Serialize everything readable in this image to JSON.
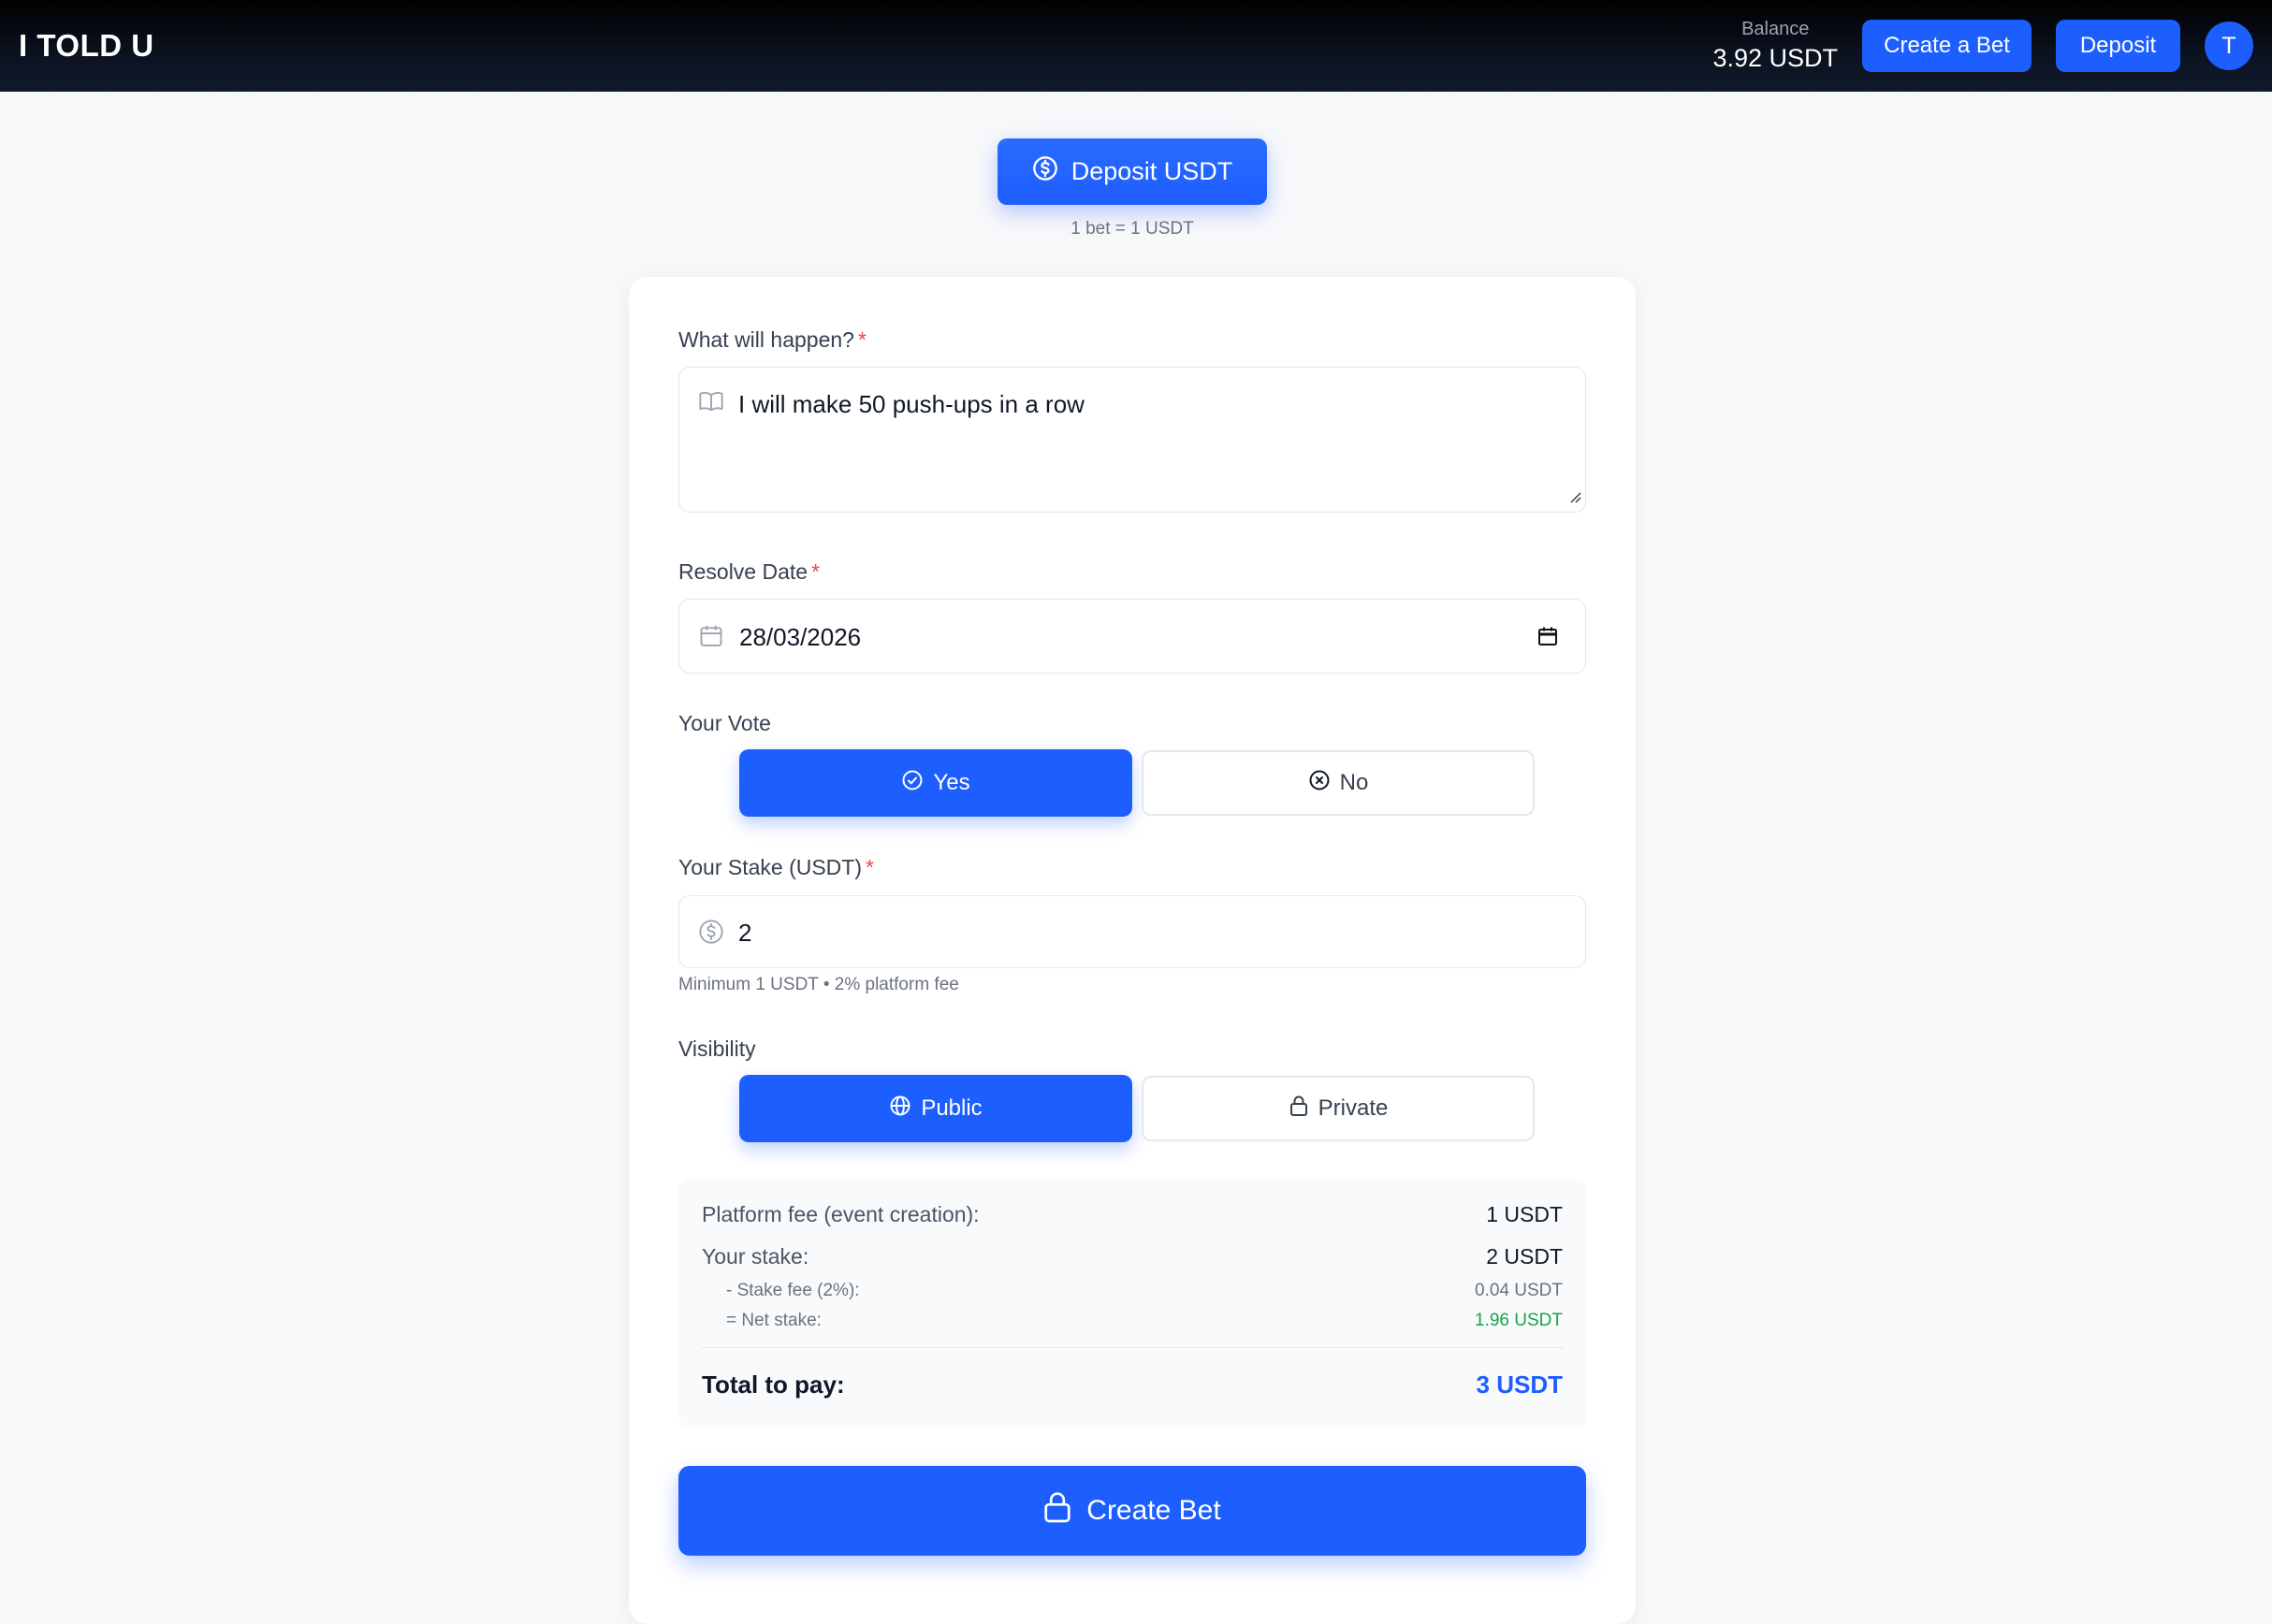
{
  "header": {
    "logo": "I TOLD U",
    "balance_label": "Balance",
    "balance_value": "3.92 USDT",
    "create_bet_label": "Create a Bet",
    "deposit_label": "Deposit",
    "avatar_initial": "T"
  },
  "deposit_banner": {
    "button_label": "Deposit USDT",
    "rate_text": "1 bet = 1 USDT"
  },
  "form": {
    "question": {
      "label": "What will happen?",
      "required_mark": "*",
      "value": "I will make 50 push-ups in a row"
    },
    "resolve_date": {
      "label": "Resolve Date",
      "required_mark": "*",
      "value": "28/03/2026"
    },
    "vote": {
      "label": "Your Vote",
      "options": [
        {
          "label": "Yes",
          "selected": true
        },
        {
          "label": "No",
          "selected": false
        }
      ]
    },
    "stake": {
      "label": "Your Stake (USDT)",
      "required_mark": "*",
      "value": "2",
      "hint": "Minimum 1 USDT • 2% platform fee"
    },
    "visibility": {
      "label": "Visibility",
      "options": [
        {
          "label": "Public",
          "selected": true
        },
        {
          "label": "Private",
          "selected": false
        }
      ]
    }
  },
  "summary": {
    "platform_fee_label": "Platform fee (event creation):",
    "platform_fee_value": "1 USDT",
    "stake_label": "Your stake:",
    "stake_value": "2 USDT",
    "stake_fee_label": "- Stake fee (2%):",
    "stake_fee_value": "0.04 USDT",
    "net_stake_label": "= Net stake:",
    "net_stake_value": "1.96 USDT",
    "total_label": "Total to pay:",
    "total_value": "3 USDT"
  },
  "submit_label": "Create Bet",
  "colors": {
    "accent": "#1d5eff",
    "required": "#ef4444",
    "positive": "#16a34a"
  }
}
